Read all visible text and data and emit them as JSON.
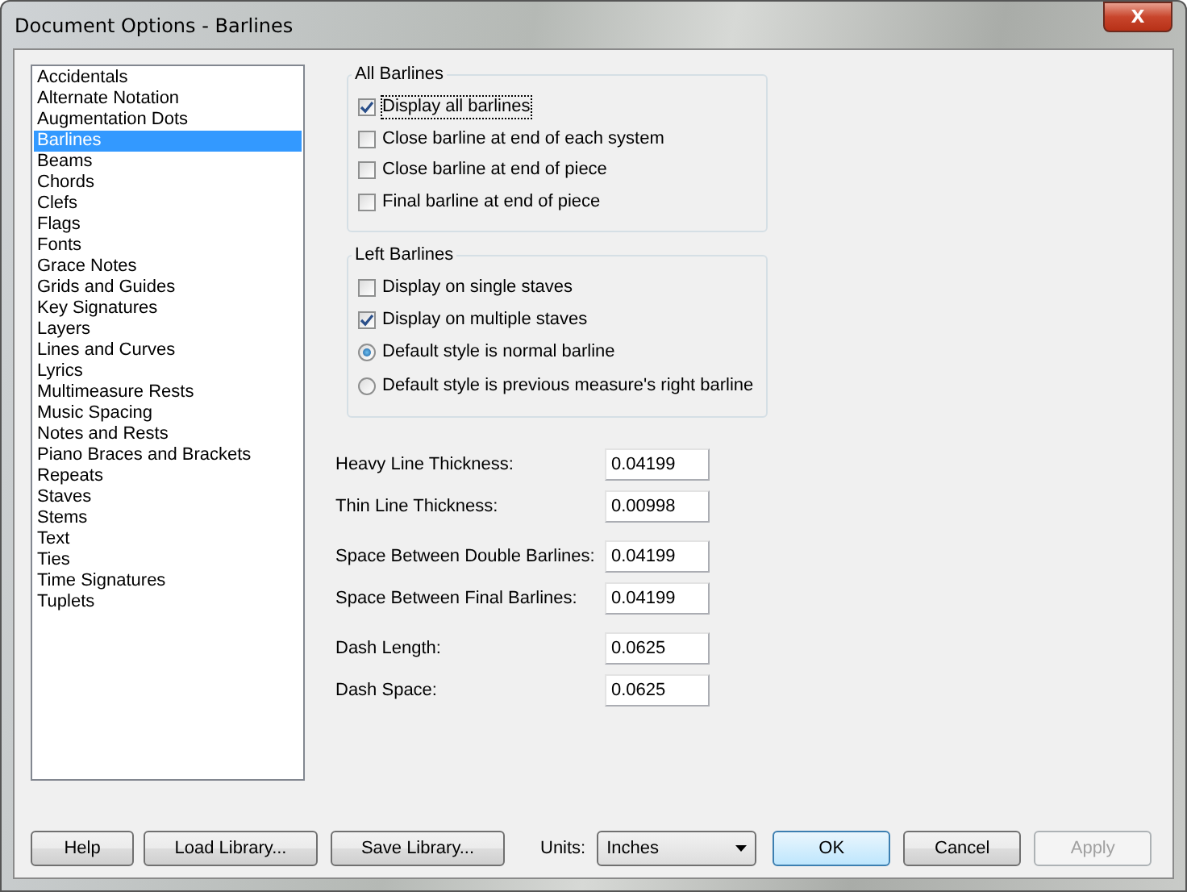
{
  "window": {
    "title": "Document Options - Barlines",
    "close": "X"
  },
  "categories": [
    {
      "label": "Accidentals",
      "selected": false
    },
    {
      "label": "Alternate Notation",
      "selected": false
    },
    {
      "label": "Augmentation Dots",
      "selected": false
    },
    {
      "label": "Barlines",
      "selected": true
    },
    {
      "label": "Beams",
      "selected": false
    },
    {
      "label": "Chords",
      "selected": false
    },
    {
      "label": "Clefs",
      "selected": false
    },
    {
      "label": "Flags",
      "selected": false
    },
    {
      "label": "Fonts",
      "selected": false
    },
    {
      "label": "Grace Notes",
      "selected": false
    },
    {
      "label": "Grids and Guides",
      "selected": false
    },
    {
      "label": "Key Signatures",
      "selected": false
    },
    {
      "label": "Layers",
      "selected": false
    },
    {
      "label": "Lines and Curves",
      "selected": false
    },
    {
      "label": "Lyrics",
      "selected": false
    },
    {
      "label": "Multimeasure Rests",
      "selected": false
    },
    {
      "label": "Music Spacing",
      "selected": false
    },
    {
      "label": "Notes and Rests",
      "selected": false
    },
    {
      "label": "Piano Braces and Brackets",
      "selected": false
    },
    {
      "label": "Repeats",
      "selected": false
    },
    {
      "label": "Staves",
      "selected": false
    },
    {
      "label": "Stems",
      "selected": false
    },
    {
      "label": "Text",
      "selected": false
    },
    {
      "label": "Ties",
      "selected": false
    },
    {
      "label": "Time Signatures",
      "selected": false
    },
    {
      "label": "Tuplets",
      "selected": false
    }
  ],
  "groups": [
    {
      "title": "All Barlines",
      "options": [
        {
          "kind": "checkbox",
          "label": "Display all barlines",
          "checked": true,
          "focused": true
        },
        {
          "kind": "checkbox",
          "label": "Close barline at end of each system",
          "checked": false,
          "focused": false
        },
        {
          "kind": "checkbox",
          "label": "Close barline at end of piece",
          "checked": false,
          "focused": false
        },
        {
          "kind": "checkbox",
          "label": "Final barline at end of piece",
          "checked": false,
          "focused": false
        }
      ]
    },
    {
      "title": "Left Barlines",
      "options": [
        {
          "kind": "checkbox",
          "label": "Display on single staves",
          "checked": false,
          "focused": false
        },
        {
          "kind": "checkbox",
          "label": "Display on multiple staves",
          "checked": true,
          "focused": false
        },
        {
          "kind": "radio",
          "label": "Default style is normal barline",
          "checked": true,
          "focused": false
        },
        {
          "kind": "radio",
          "label": "Default style is previous measure's right barline",
          "checked": false,
          "focused": false
        }
      ]
    }
  ],
  "fields": [
    {
      "label": "Heavy Line Thickness:",
      "value": "0.04199"
    },
    {
      "label": "Thin Line Thickness:",
      "value": "0.00998"
    },
    {
      "label": "Space Between Double Barlines:",
      "value": "0.04199"
    },
    {
      "label": "Space Between Final Barlines:",
      "value": "0.04199"
    },
    {
      "label": "Dash Length:",
      "value": "0.0625"
    },
    {
      "label": "Dash Space:",
      "value": "0.0625"
    }
  ],
  "footer": {
    "help": "Help",
    "load": "Load Library...",
    "save": "Save Library...",
    "units_label": "Units:",
    "units": "Inches",
    "ok": "OK",
    "cancel": "Cancel",
    "apply": "Apply",
    "apply_disabled": true
  }
}
